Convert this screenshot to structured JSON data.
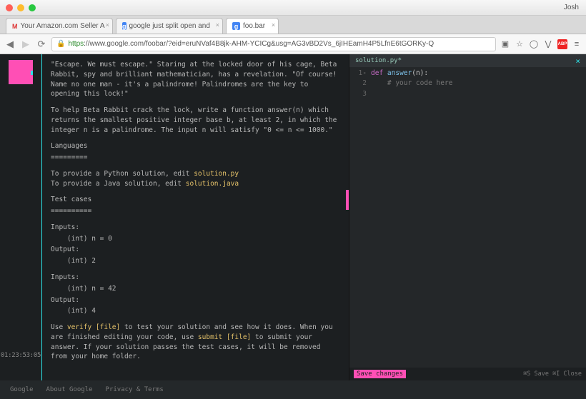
{
  "chrome": {
    "profile": "Josh",
    "tabs": [
      {
        "label": "Your Amazon.com Seller A",
        "fav": "M"
      },
      {
        "label": "google just split open and",
        "fav": "g"
      },
      {
        "label": "foo.bar",
        "fav": "g"
      }
    ],
    "url_https": "https",
    "url_rest": "://www.google.com/foobar/?eid=eruNVaf4B8jk-AHM-YCICg&usg=AG3vBD2Vs_6jIHEamH4P5LfnE6tGORKy-Q"
  },
  "problem": {
    "p1": "\"Escape. We must escape.\" Staring at the locked door of his cage, Beta Rabbit, spy and brilliant mathematician, has a revelation. \"Of course! Name no one man - it's a palindrome! Palindromes are the key to opening this lock!\"",
    "p2": "To help Beta Rabbit crack the lock, write a function answer(n) which returns the smallest positive integer base b, at least 2, in which the integer n is a palindrome. The input n will satisfy \"0 <= n <= 1000.\"",
    "lang_h": "Languages",
    "lang_r": "=========",
    "py_pre": "To provide a Python solution, edit ",
    "py_file": "solution.py",
    "java_pre": "To provide a Java solution, edit ",
    "java_file": "solution.java",
    "tc_h": "Test cases",
    "tc_r": "==========",
    "t1_in_h": "Inputs:",
    "t1_in": "    (int) n = 0",
    "t1_out_h": "Output:",
    "t1_out": "    (int) 2",
    "t2_in_h": "Inputs:",
    "t2_in": "    (int) n = 42",
    "t2_out_h": "Output:",
    "t2_out": "    (int) 4",
    "hint_pre1": "Use ",
    "hint_cmd1": "verify [file]",
    "hint_mid": " to test your solution and see how it does. When you are finished editing your code, use ",
    "hint_cmd2": "submit [file]",
    "hint_post": " to submit your answer. If your solution passes the test cases, it will be removed from your home folder."
  },
  "timer": "01:23:53:05",
  "editor": {
    "filename": "solution.py*",
    "lines": [
      {
        "n": "1",
        "fold": "-",
        "kw": "def",
        "fn": "answer",
        "rest": "(n):"
      },
      {
        "n": "2",
        "fold": "",
        "comment": "    # your code here"
      },
      {
        "n": "3",
        "fold": "",
        "comment": ""
      }
    ],
    "save": "Save changes",
    "hints": "⌘S Save   ⌘I Close"
  },
  "footer": {
    "a": "Google",
    "b": "About Google",
    "c": "Privacy & Terms"
  }
}
